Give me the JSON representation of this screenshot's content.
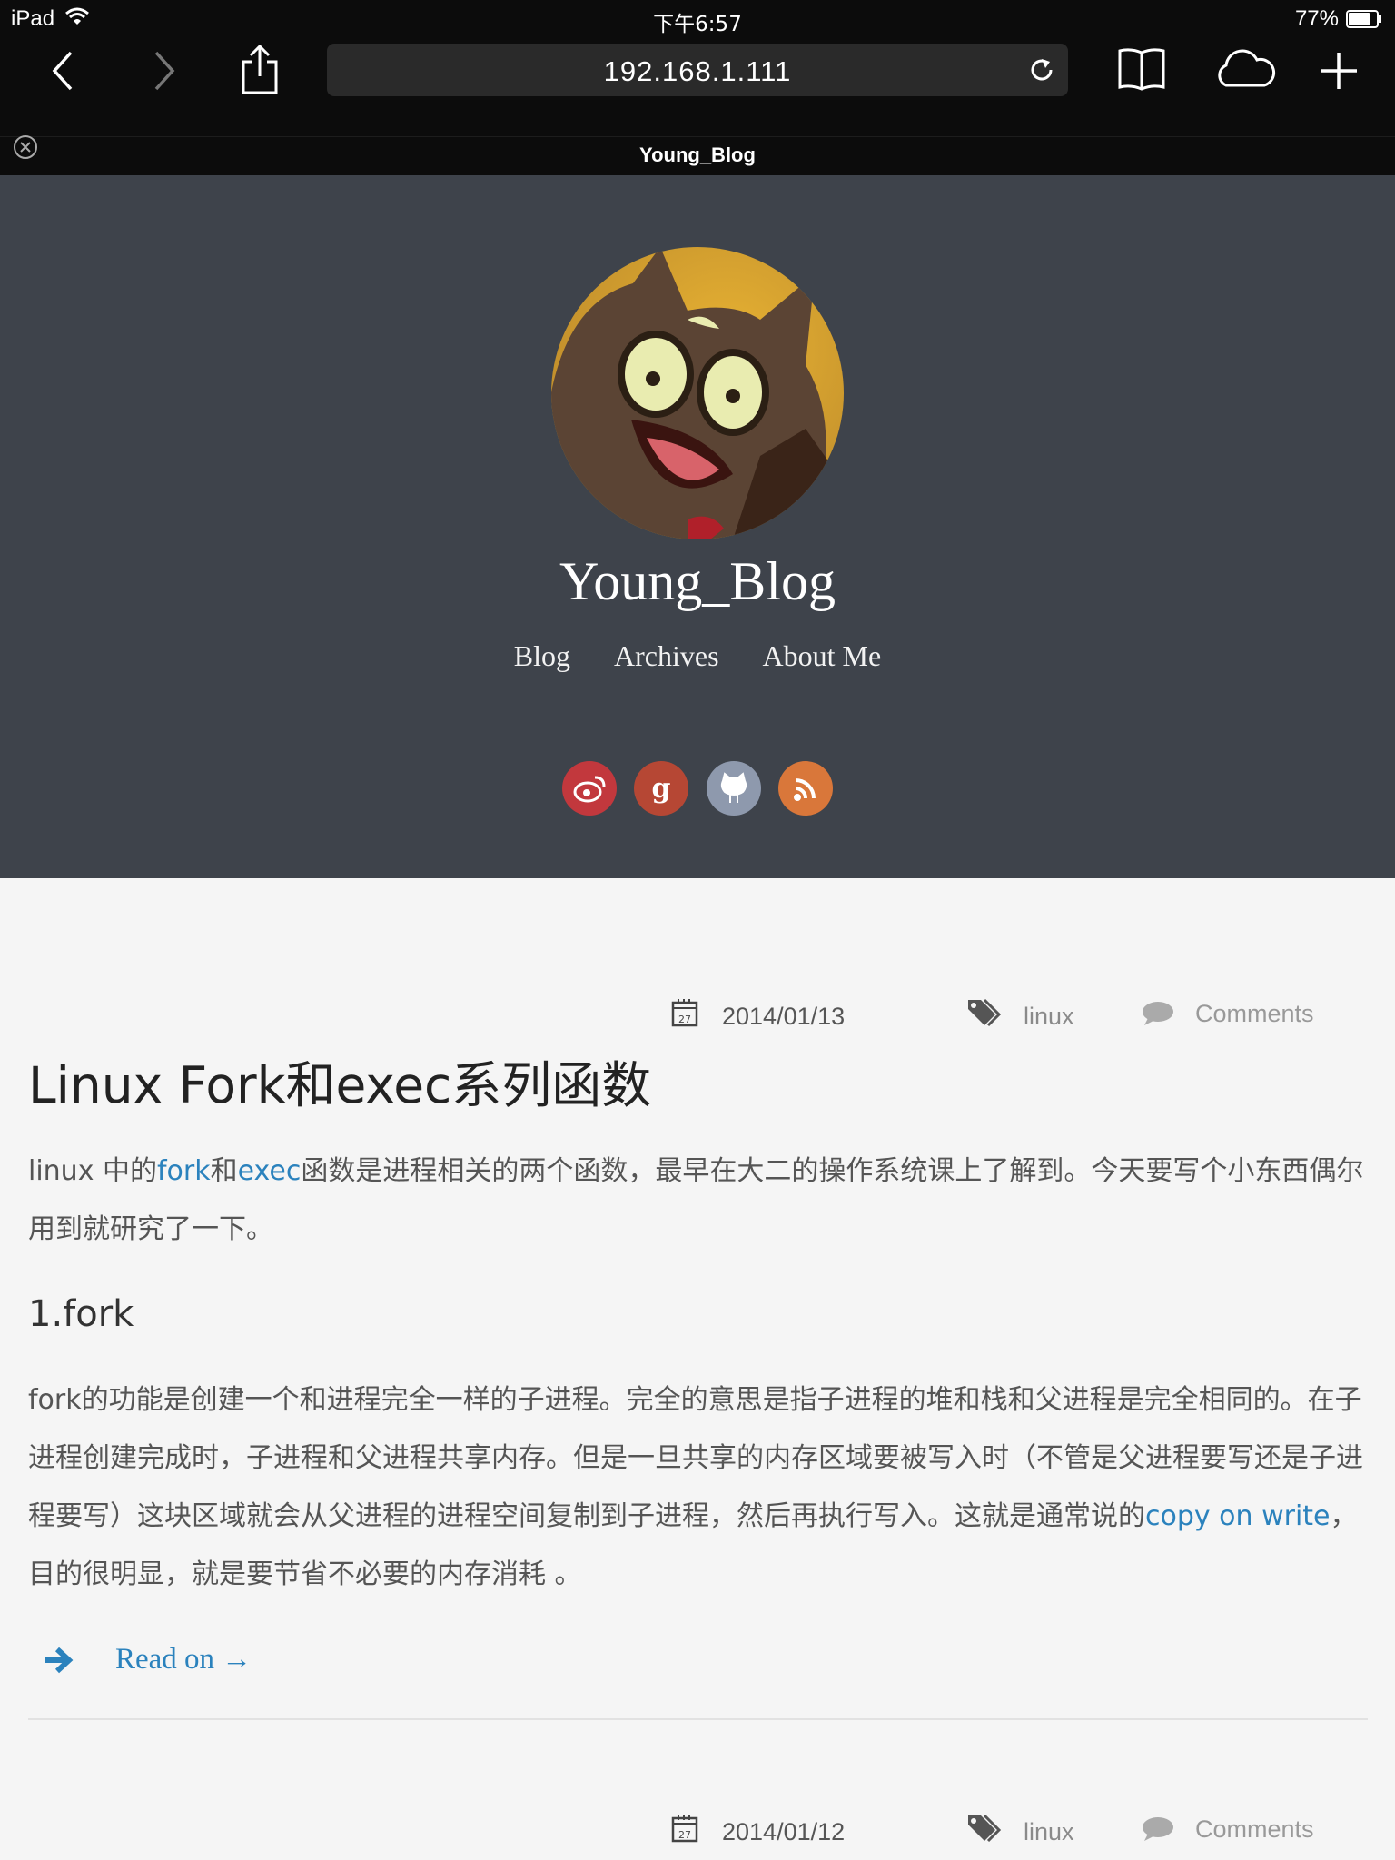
{
  "status_bar": {
    "device": "iPad",
    "time": "下午6:57",
    "battery": "77%",
    "battery_level": 0.77
  },
  "browser": {
    "url": "192.168.1.111",
    "tab_title": "Young_Blog"
  },
  "blog": {
    "title": "Young_Blog",
    "nav": [
      "Blog",
      "Archives",
      "About Me"
    ],
    "socials": [
      {
        "name": "weibo",
        "color": "#c2383d"
      },
      {
        "name": "google-plus",
        "color": "#b64734"
      },
      {
        "name": "github",
        "color": "#8e99ad"
      },
      {
        "name": "rss",
        "color": "#d9773a"
      }
    ]
  },
  "posts": [
    {
      "date": "2014/01/13",
      "tag": "linux",
      "comments": "Comments",
      "title": "Linux Fork和exec系列函数",
      "intro_a": "linux 中的",
      "intro_link1": "fork",
      "intro_b": "和",
      "intro_link2": "exec",
      "intro_c": "函数是进程相关的两个函数，最早在大二的操作系统课上了解到。今天要写个小东西偶尔用到就研究了一下。",
      "section_heading": "1.fork",
      "body_a": "fork的功能是创建一个和进程完全一样的子进程。完全的意思是指子进程的堆和栈和父进程是完全相同的。在子进程创建完成时，子进程和父进程共享内存。但是一旦共享的内存区域要被写入时（不管是父进程要写还是子进程要写）这块区域就会从父进程的进程空间复制到子进程，然后再执行写入。这就是通常说的",
      "body_link": "copy on write",
      "body_b": "，目的很明显，就是要节省不必要的内存消耗 。",
      "read_on": "Read on →"
    },
    {
      "date": "2014/01/12",
      "tag": "linux",
      "comments": "Comments"
    }
  ],
  "colors": {
    "header_bg": "#3e434b",
    "link": "#2b82bd",
    "page_bg": "#f5f5f5"
  }
}
